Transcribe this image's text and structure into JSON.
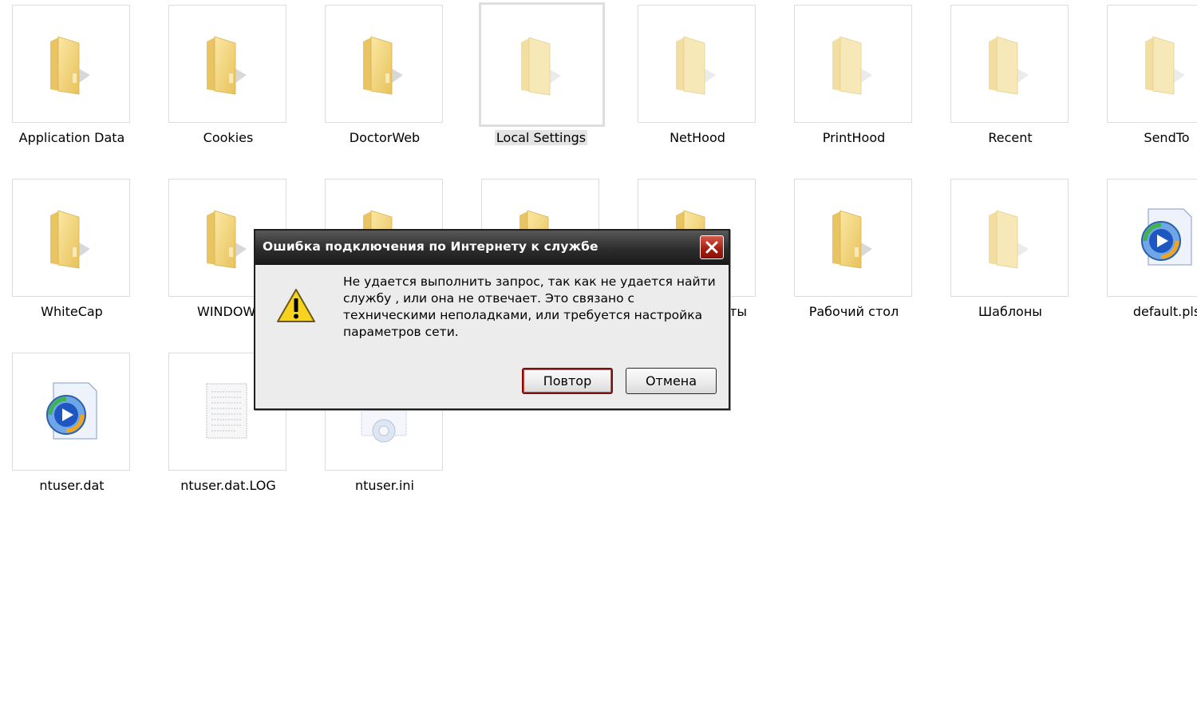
{
  "desktop": {
    "row1": [
      {
        "label": "Application Data",
        "icon": "folder-icon"
      },
      {
        "label": "Cookies",
        "icon": "folder-icon"
      },
      {
        "label": "DoctorWeb",
        "icon": "folder-icon"
      },
      {
        "label": "Local Settings",
        "icon": "folder-icon",
        "selected": true
      },
      {
        "label": "NetHood",
        "icon": "folder-icon"
      },
      {
        "label": "PrintHood",
        "icon": "folder-icon"
      },
      {
        "label": "Recent",
        "icon": "folder-icon"
      },
      {
        "label": "SendTo",
        "icon": "folder-icon"
      }
    ],
    "row2": [
      {
        "label": "WhiteCap",
        "icon": "folder-icon"
      },
      {
        "label": "WINDOW",
        "icon": "folder-icon"
      },
      {
        "label": "",
        "icon": "folder-icon"
      },
      {
        "label": "",
        "icon": "folder-icon"
      },
      {
        "label": "ты",
        "icon": "folder-icon"
      },
      {
        "label": "Рабочий стол",
        "icon": "folder-icon"
      },
      {
        "label": "Шаблоны",
        "icon": "folder-icon"
      },
      {
        "label": "default.pls",
        "icon": "media-player-file-icon"
      }
    ],
    "row3": [
      {
        "label": "ntuser.dat",
        "icon": "media-player-file-icon"
      },
      {
        "label": "ntuser.dat.LOG",
        "icon": "text-document-icon"
      },
      {
        "label": "ntuser.ini",
        "icon": "settings-file-icon"
      }
    ]
  },
  "dialog": {
    "title": "Ошибка подключения по Интернету к службе",
    "message": "Не удается выполнить запрос, так как не удается найти службу , или она не отвечает. Это связано с техническими неполадками, или требуется настройка параметров сети.",
    "retry_label": "Повтор",
    "cancel_label": "Отмена",
    "icon": "warning-icon",
    "close_icon": "close-icon"
  },
  "colors": {
    "titlebar": "#2d2d2d",
    "close_button": "#a11d10",
    "dialog_bg": "#ececec",
    "folder": "#f3d47c"
  }
}
